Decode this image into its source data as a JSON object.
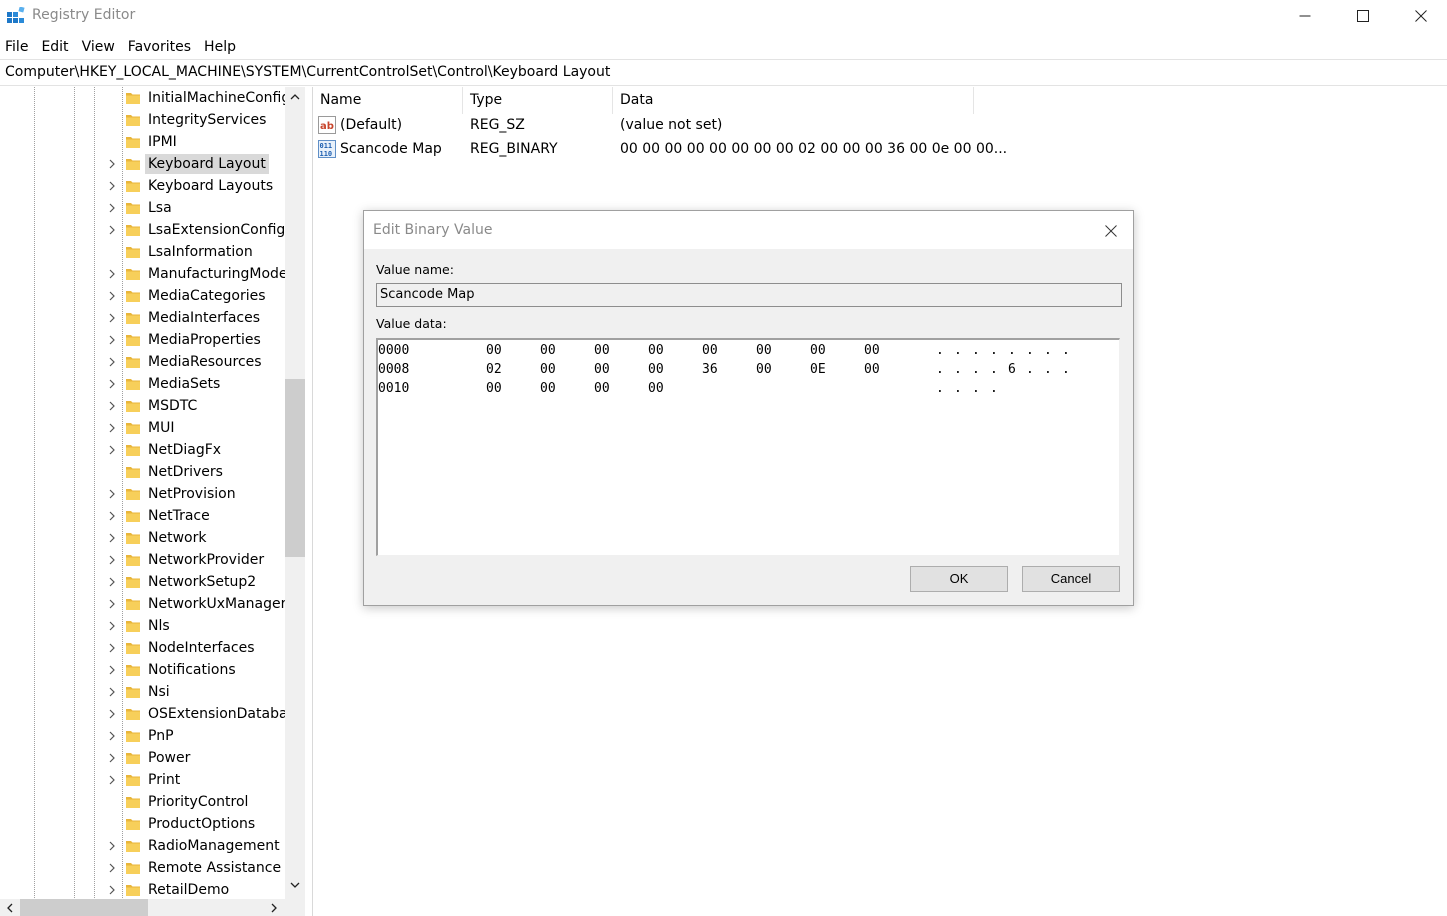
{
  "window": {
    "title": "Registry Editor",
    "minimize_glyph": "—",
    "maximize_glyph": "☐",
    "close_glyph": "✕"
  },
  "menu": [
    "File",
    "Edit",
    "View",
    "Favorites",
    "Help"
  ],
  "address": "Computer\\HKEY_LOCAL_MACHINE\\SYSTEM\\CurrentControlSet\\Control\\Keyboard Layout",
  "tree": {
    "items": [
      {
        "label": "InitialMachineConfig",
        "expandable": false
      },
      {
        "label": "IntegrityServices",
        "expandable": false
      },
      {
        "label": "IPMI",
        "expandable": false
      },
      {
        "label": "Keyboard Layout",
        "expandable": true,
        "selected": true
      },
      {
        "label": "Keyboard Layouts",
        "expandable": true
      },
      {
        "label": "Lsa",
        "expandable": true
      },
      {
        "label": "LsaExtensionConfig",
        "expandable": true
      },
      {
        "label": "LsaInformation",
        "expandable": false
      },
      {
        "label": "ManufacturingMode",
        "expandable": true
      },
      {
        "label": "MediaCategories",
        "expandable": true
      },
      {
        "label": "MediaInterfaces",
        "expandable": true
      },
      {
        "label": "MediaProperties",
        "expandable": true
      },
      {
        "label": "MediaResources",
        "expandable": true
      },
      {
        "label": "MediaSets",
        "expandable": true
      },
      {
        "label": "MSDTC",
        "expandable": true
      },
      {
        "label": "MUI",
        "expandable": true
      },
      {
        "label": "NetDiagFx",
        "expandable": true
      },
      {
        "label": "NetDrivers",
        "expandable": false
      },
      {
        "label": "NetProvision",
        "expandable": true
      },
      {
        "label": "NetTrace",
        "expandable": true
      },
      {
        "label": "Network",
        "expandable": true
      },
      {
        "label": "NetworkProvider",
        "expandable": true
      },
      {
        "label": "NetworkSetup2",
        "expandable": true
      },
      {
        "label": "NetworkUxManager",
        "expandable": true
      },
      {
        "label": "Nls",
        "expandable": true
      },
      {
        "label": "NodeInterfaces",
        "expandable": true
      },
      {
        "label": "Notifications",
        "expandable": true
      },
      {
        "label": "Nsi",
        "expandable": true
      },
      {
        "label": "OSExtensionDatabas",
        "expandable": true
      },
      {
        "label": "PnP",
        "expandable": true
      },
      {
        "label": "Power",
        "expandable": true
      },
      {
        "label": "Print",
        "expandable": true
      },
      {
        "label": "PriorityControl",
        "expandable": false
      },
      {
        "label": "ProductOptions",
        "expandable": false
      },
      {
        "label": "RadioManagement",
        "expandable": true
      },
      {
        "label": "Remote Assistance",
        "expandable": true
      },
      {
        "label": "RetailDemo",
        "expandable": true
      }
    ]
  },
  "list": {
    "columns": [
      "Name",
      "Type",
      "Data"
    ],
    "rows": [
      {
        "name": "(Default)",
        "type": "REG_SZ",
        "data": "(value not set)",
        "icon": "string-value-icon"
      },
      {
        "name": "Scancode Map",
        "type": "REG_BINARY",
        "data": "00 00 00 00 00 00 00 00 02 00 00 00 36 00 0e 00 00...",
        "icon": "binary-value-icon"
      }
    ]
  },
  "dialog": {
    "title": "Edit Binary Value",
    "value_name_label": "Value name:",
    "value_name": "Scancode Map",
    "value_data_label": "Value data:",
    "hex_rows": [
      {
        "offset": "0000",
        "bytes": [
          "00",
          "00",
          "00",
          "00",
          "00",
          "00",
          "00",
          "00"
        ],
        "ascii": [
          ".",
          ".",
          ".",
          ".",
          ".",
          ".",
          ".",
          "."
        ]
      },
      {
        "offset": "0008",
        "bytes": [
          "02",
          "00",
          "00",
          "00",
          "36",
          "00",
          "0E",
          "00"
        ],
        "ascii": [
          ".",
          ".",
          ".",
          ".",
          "6",
          ".",
          ".",
          "."
        ]
      },
      {
        "offset": "0010",
        "bytes": [
          "00",
          "00",
          "00",
          "00"
        ],
        "ascii": [
          ".",
          ".",
          ".",
          "."
        ]
      }
    ],
    "ok_label": "OK",
    "cancel_label": "Cancel"
  }
}
